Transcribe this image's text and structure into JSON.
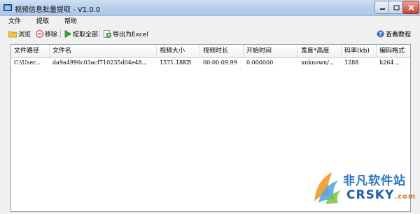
{
  "window": {
    "title": "视频信息批量提取 - V1.0.0"
  },
  "menu": [
    "文件",
    "提取",
    "帮助"
  ],
  "toolbar": {
    "browse": "浏览",
    "remove": "移除",
    "extract_all": "提取全部",
    "export_excel": "导出为Excel",
    "help": "查看教程"
  },
  "table": {
    "columns": [
      "文件路径",
      "文件名",
      "视频大小",
      "视频时长",
      "开始时间",
      "宽度*高度",
      "码率(kb)",
      "编码格式"
    ],
    "rows": [
      [
        "C:\\User...",
        "da9a4996c03acf710235d04e48...",
        "1571.18KB",
        "00:00:09.99",
        "0.000000",
        "unknown/...",
        "1288",
        "h264 ..."
      ]
    ]
  },
  "watermark": {
    "cn": "非凡软件站",
    "en": "CRSKY",
    "en_suffix": ".com"
  },
  "colors": {
    "titlebar": "#b9d1ec",
    "close": "#c8442e",
    "watermark_blue": "#2a79c4",
    "watermark_orange": "#e07a1f"
  }
}
